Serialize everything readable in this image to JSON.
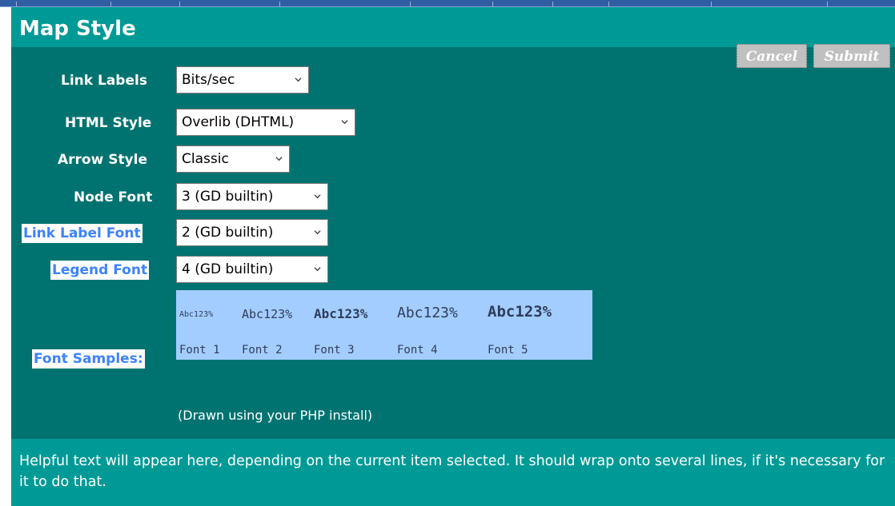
{
  "panel": {
    "title": "Map Style",
    "buttons": {
      "cancel": "Cancel",
      "submit": "Submit"
    }
  },
  "fields": [
    {
      "label": "Link Labels",
      "value": "Bits/sec",
      "highlighted": false
    },
    {
      "label": "HTML Style",
      "value": "Overlib (DHTML)",
      "highlighted": false
    },
    {
      "label": "Arrow Style",
      "value": "Classic",
      "highlighted": false
    },
    {
      "label": "Node Font",
      "value": "3 (GD builtin)",
      "highlighted": false
    },
    {
      "label": "Link Label Font",
      "value": "2 (GD builtin)",
      "highlighted": true
    },
    {
      "label": "Legend Font",
      "value": "4 (GD builtin)",
      "highlighted": true
    }
  ],
  "font_samples": {
    "label": "Font Samples:",
    "sample_text": "Abc123%",
    "font_names": [
      "Font 1",
      "Font 2",
      "Font 3",
      "Font 4",
      "Font 5"
    ],
    "note": "(Drawn using your PHP install)"
  },
  "help_text": "Helpful text will appear here, depending on the current item selected. It should wrap onto several lines, if it's necessary for it to do that.",
  "colors": {
    "panel_background": "#007370",
    "header_background": "#009a96",
    "highlight_label_text": "#3c82ff",
    "samples_background": "#a3cdff",
    "button_background": "#c0c0c0"
  },
  "icons": {
    "dropdown": "chevron-down-icon"
  }
}
